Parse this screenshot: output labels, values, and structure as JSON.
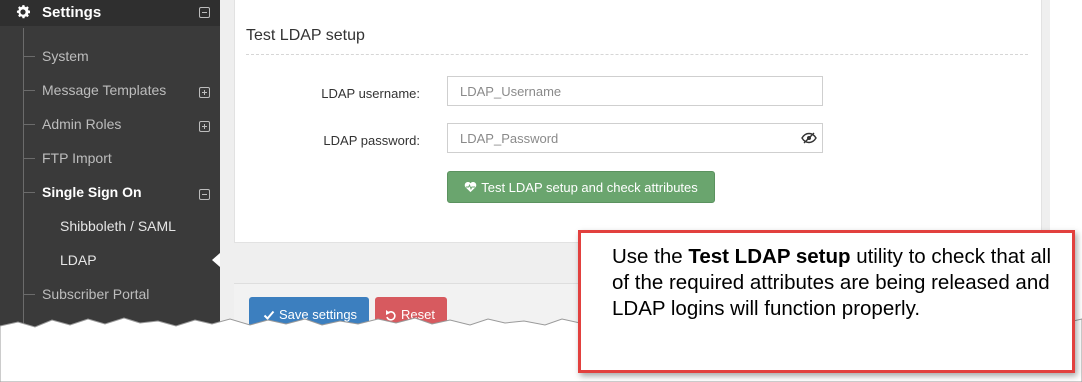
{
  "sidebar": {
    "header": {
      "label": "Settings",
      "icon": "gear-icon"
    },
    "items": [
      {
        "label": "System"
      },
      {
        "label": "Message Templates"
      },
      {
        "label": "Admin Roles"
      },
      {
        "label": "FTP Import"
      },
      {
        "label": "Single Sign On"
      },
      {
        "label": "Shibboleth / SAML"
      },
      {
        "label": "LDAP"
      },
      {
        "label": "Subscriber Portal"
      }
    ]
  },
  "main": {
    "section_title": "Test LDAP setup",
    "username": {
      "label": "LDAP username:",
      "placeholder": "LDAP_Username"
    },
    "password": {
      "label": "LDAP password:",
      "placeholder": "LDAP_Password"
    },
    "test_button": "Test LDAP setup and check attributes",
    "save_button": "Save settings",
    "reset_button": "Reset"
  },
  "callout": {
    "prefix": "Use the ",
    "bold": "Test LDAP setup",
    "suffix": " utility to check that all of the required attributes are being released and LDAP logins will function properly."
  },
  "colors": {
    "sidebar_bg": "#3a3a3a",
    "test_button": "#6aa56e",
    "save_button": "#3c7fbf",
    "reset_button": "#d75a5f",
    "callout_border": "#e2403e"
  }
}
